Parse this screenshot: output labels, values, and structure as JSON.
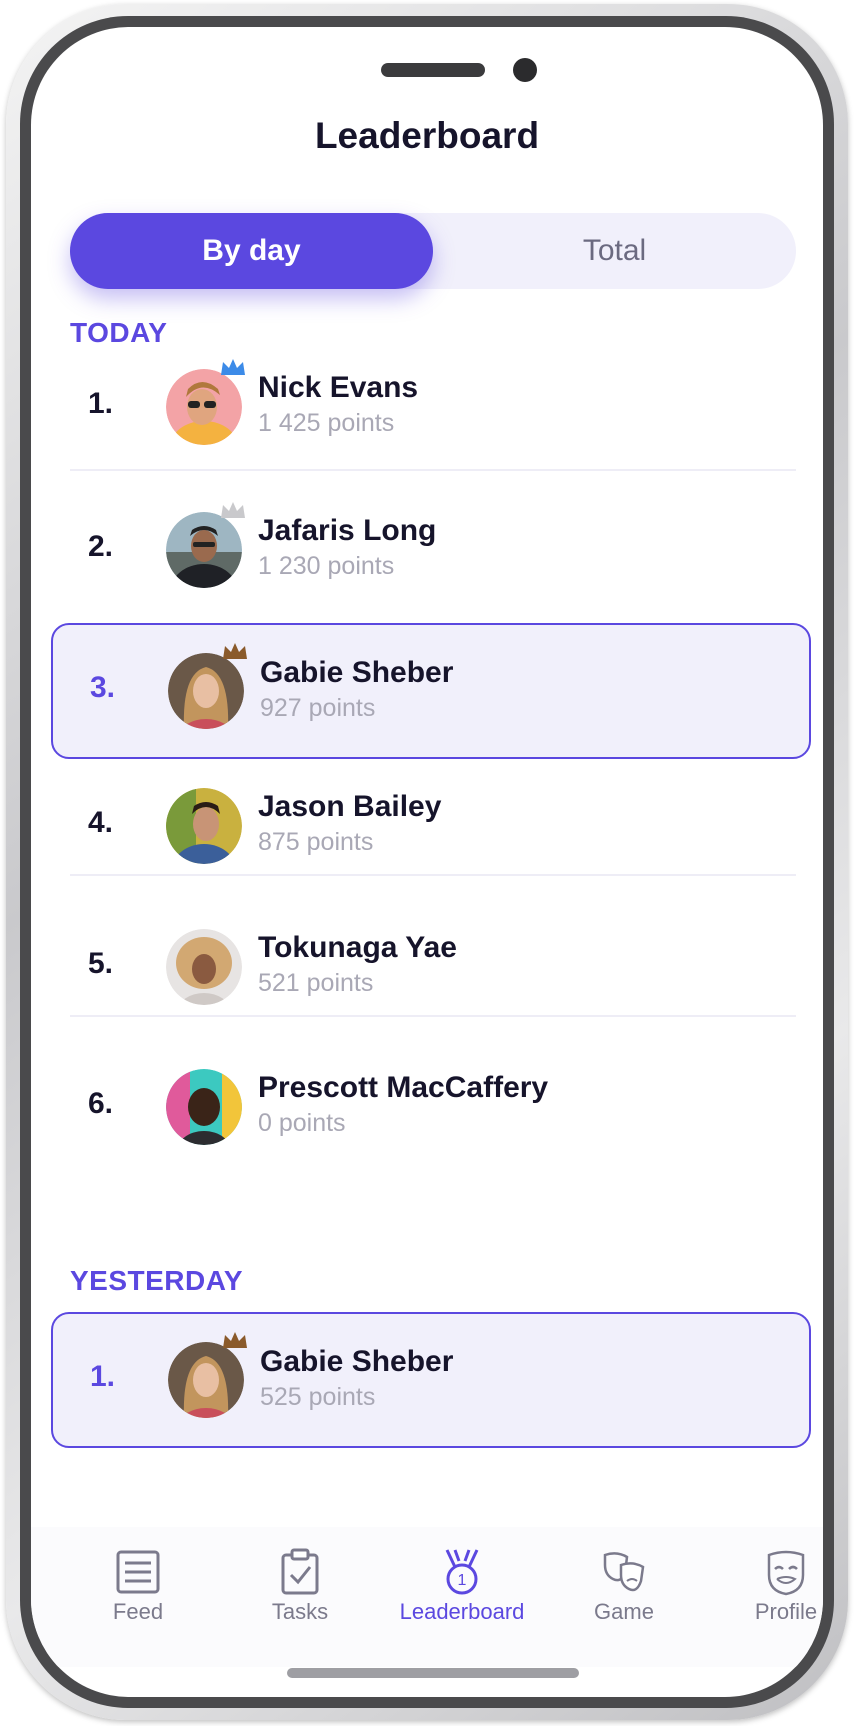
{
  "header": {
    "title": "Leaderboard"
  },
  "segments": {
    "by_day": "By day",
    "total": "Total"
  },
  "today": {
    "label": "TODAY",
    "entries": [
      {
        "rank": "1.",
        "name": "Nick Evans",
        "points": "1 425 points",
        "crown": "gold-crown"
      },
      {
        "rank": "2.",
        "name": "Jafaris Long",
        "points": "1 230 points",
        "crown": "silver-crown"
      },
      {
        "rank": "3.",
        "name": "Gabie Sheber",
        "points": "927 points",
        "crown": "bronze-crown"
      },
      {
        "rank": "4.",
        "name": "Jason Bailey",
        "points": "875 points"
      },
      {
        "rank": "5.",
        "name": "Tokunaga Yae",
        "points": "521 points"
      },
      {
        "rank": "6.",
        "name": "Prescott MacCaffery",
        "points": "0 points"
      }
    ]
  },
  "yesterday": {
    "label": "YESTERDAY",
    "entries": [
      {
        "rank": "1.",
        "name": "Gabie Sheber",
        "points": "525 points",
        "crown": "bronze-crown"
      }
    ]
  },
  "tabs": [
    {
      "label": "Feed",
      "icon": "feed-icon"
    },
    {
      "label": "Tasks",
      "icon": "clipboard-check-icon"
    },
    {
      "label": "Leaderboard",
      "icon": "medal-icon"
    },
    {
      "label": "Game",
      "icon": "theater-masks-icon"
    },
    {
      "label": "Profile",
      "icon": "mask-icon"
    }
  ],
  "colors": {
    "accent": "#5b48e0",
    "accent_light": "#f1f0fb",
    "text": "#16142b",
    "muted": "#a9a8b5",
    "gold": "#3c8be8",
    "silver": "#c9c9cc",
    "bronze": "#8a5a2b"
  }
}
